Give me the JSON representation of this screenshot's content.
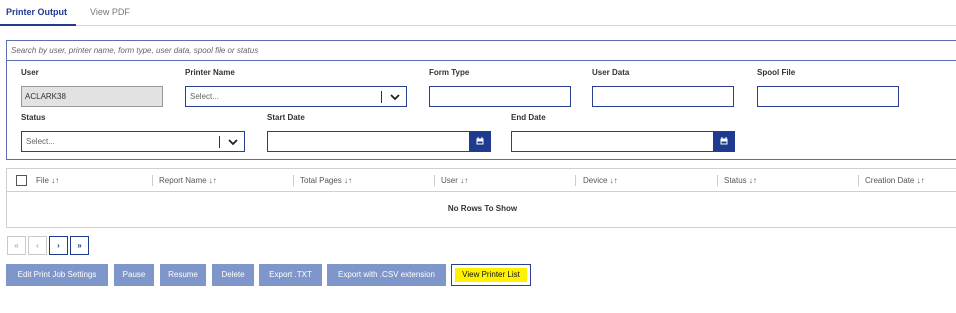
{
  "tabs": {
    "printer_output": "Printer Output",
    "view_pdf": "View PDF"
  },
  "search": {
    "placeholder": "Search by user, printer name, form type, user data, spool file or status"
  },
  "filters": {
    "user_label": "User",
    "user_value": "ACLARK38",
    "printer_name_label": "Printer Name",
    "printer_name_placeholder": "Select...",
    "form_type_label": "Form Type",
    "user_data_label": "User Data",
    "spool_file_label": "Spool File",
    "status_label": "Status",
    "status_placeholder": "Select...",
    "start_date_label": "Start Date",
    "end_date_label": "End Date"
  },
  "grid": {
    "columns": [
      "File ↓↑",
      "Report Name ↓↑",
      "Total Pages ↓↑",
      "User ↓↑",
      "Device ↓↑",
      "Status ↓↑",
      "Creation Date ↓↑"
    ],
    "empty_message": "No Rows To Show"
  },
  "pager": {
    "first": "«",
    "prev": "‹",
    "next": "›",
    "last": "»"
  },
  "actions": {
    "edit": "Edit Print Job Settings",
    "pause": "Pause",
    "resume": "Resume",
    "delete": "Delete",
    "export_txt": "Export .TXT",
    "export_csv": "Export with .CSV extension",
    "view_printer_list": "View Printer List"
  },
  "colors": {
    "accent": "#1f3b8f",
    "button": "#7e96c9",
    "highlight": "#fff200"
  }
}
